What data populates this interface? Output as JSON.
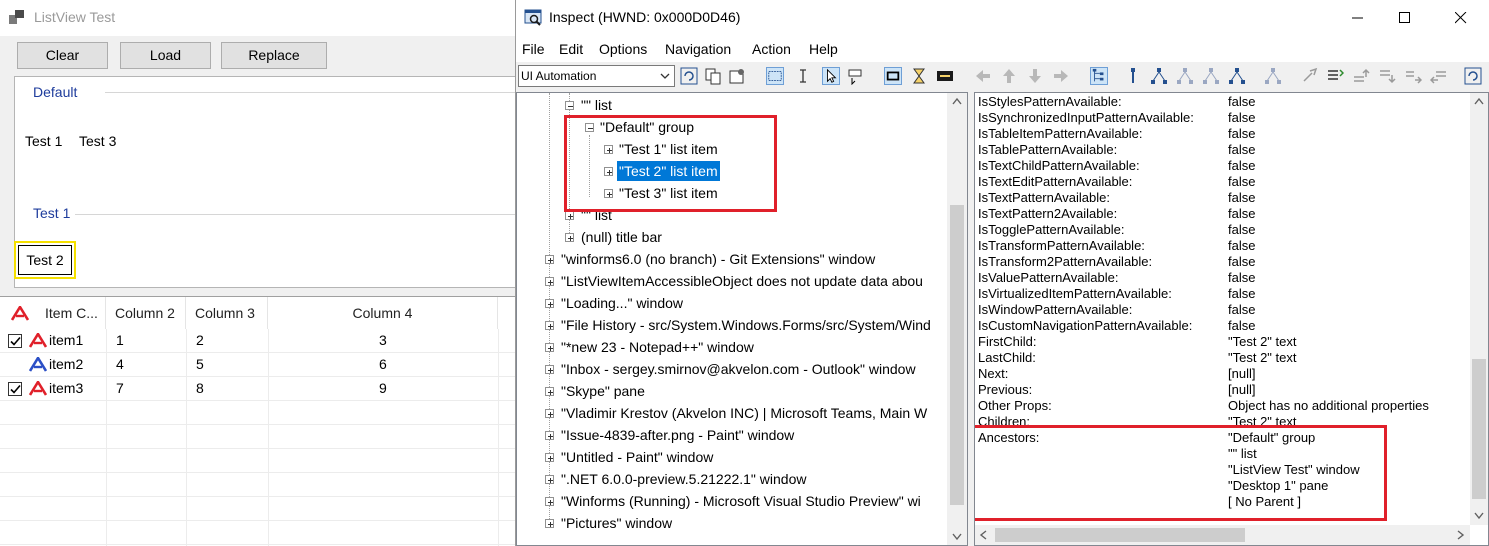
{
  "listview_window": {
    "title": "ListView Test",
    "buttons": {
      "clear": "Clear",
      "load": "Load",
      "replace": "Replace"
    },
    "groups": [
      {
        "header": "Default",
        "items": [
          "Test 1",
          "Test 3"
        ]
      },
      {
        "header": "Test 1",
        "items": [
          "Test 2"
        ]
      }
    ],
    "details": {
      "columns": [
        "Item C...",
        "Column 2",
        "Column 3",
        "Column 4"
      ],
      "rows": [
        {
          "checked": true,
          "name": "item1",
          "c2": "1",
          "c3": "2",
          "c4": "3"
        },
        {
          "checked": false,
          "name": "item2",
          "c2": "4",
          "c3": "5",
          "c4": "6"
        },
        {
          "checked": true,
          "name": "item3",
          "c2": "7",
          "c3": "8",
          "c4": "9"
        }
      ]
    }
  },
  "inspect_window": {
    "title": "Inspect  (HWND: 0x000D0D46)",
    "menu": [
      "File",
      "Edit",
      "Options",
      "Navigation",
      "Action",
      "Help"
    ],
    "mode": "UI Automation",
    "tree": [
      "\"\" list",
      "\"Default\" group",
      "\"Test 1\" list item",
      "\"Test 2\" list item",
      "\"Test 3\" list item",
      "\"\" list",
      "(null) title bar",
      "\"winforms6.0 (no branch) - Git Extensions\" window",
      "\"ListViewItemAccessibleObject does not update data abou",
      "\"Loading...\" window",
      "\"File History - src/System.Windows.Forms/src/System/Wind",
      "\"*new 23 - Notepad++\" window",
      "\"Inbox - sergey.smirnov@akvelon.com - Outlook\" window",
      "\"Skype\" pane",
      "\"Vladimir Krestov (Akvelon INC) | Microsoft Teams, Main W",
      "\"Issue-4839-after.png - Paint\" window",
      "\"Untitled - Paint\" window",
      "\".NET 6.0.0-preview.5.21222.1\" window",
      "\"Winforms (Running) - Microsoft Visual Studio Preview\" wi",
      "\"Pictures\" window"
    ],
    "properties": [
      {
        "name": "IsStylesPatternAvailable:",
        "value": "false"
      },
      {
        "name": "IsSynchronizedInputPatternAvailable:",
        "value": "false"
      },
      {
        "name": "IsTableItemPatternAvailable:",
        "value": "false"
      },
      {
        "name": "IsTablePatternAvailable:",
        "value": "false"
      },
      {
        "name": "IsTextChildPatternAvailable:",
        "value": "false"
      },
      {
        "name": "IsTextEditPatternAvailable:",
        "value": "false"
      },
      {
        "name": "IsTextPatternAvailable:",
        "value": "false"
      },
      {
        "name": "IsTextPattern2Available:",
        "value": "false"
      },
      {
        "name": "IsTogglePatternAvailable:",
        "value": "false"
      },
      {
        "name": "IsTransformPatternAvailable:",
        "value": "false"
      },
      {
        "name": "IsTransform2PatternAvailable:",
        "value": "false"
      },
      {
        "name": "IsValuePatternAvailable:",
        "value": "false"
      },
      {
        "name": "IsVirtualizedItemPatternAvailable:",
        "value": "false"
      },
      {
        "name": "IsWindowPatternAvailable:",
        "value": "false"
      },
      {
        "name": "IsCustomNavigationPatternAvailable:",
        "value": "false"
      },
      {
        "name": "FirstChild:",
        "value": "\"Test 2\" text"
      },
      {
        "name": "LastChild:",
        "value": "\"Test 2\" text"
      },
      {
        "name": "Next:",
        "value": "[null]"
      },
      {
        "name": "Previous:",
        "value": "[null]"
      },
      {
        "name": "Other Props:",
        "value": "Object has no additional properties"
      },
      {
        "name": "Children:",
        "value": "\"Test 2\" text"
      },
      {
        "name": "Ancestors:",
        "value": "\"Default\" group"
      },
      {
        "name": "",
        "value": "\"\" list"
      },
      {
        "name": "",
        "value": "\"ListView Test\" window"
      },
      {
        "name": "",
        "value": "\"Desktop 1\" pane"
      },
      {
        "name": "",
        "value": "[ No Parent ]"
      }
    ]
  },
  "colors": {
    "selection": "#0078d7",
    "highlight_box": "#e0202a",
    "group_header": "#1e3c9c",
    "focus_frame": "#f5e000"
  }
}
